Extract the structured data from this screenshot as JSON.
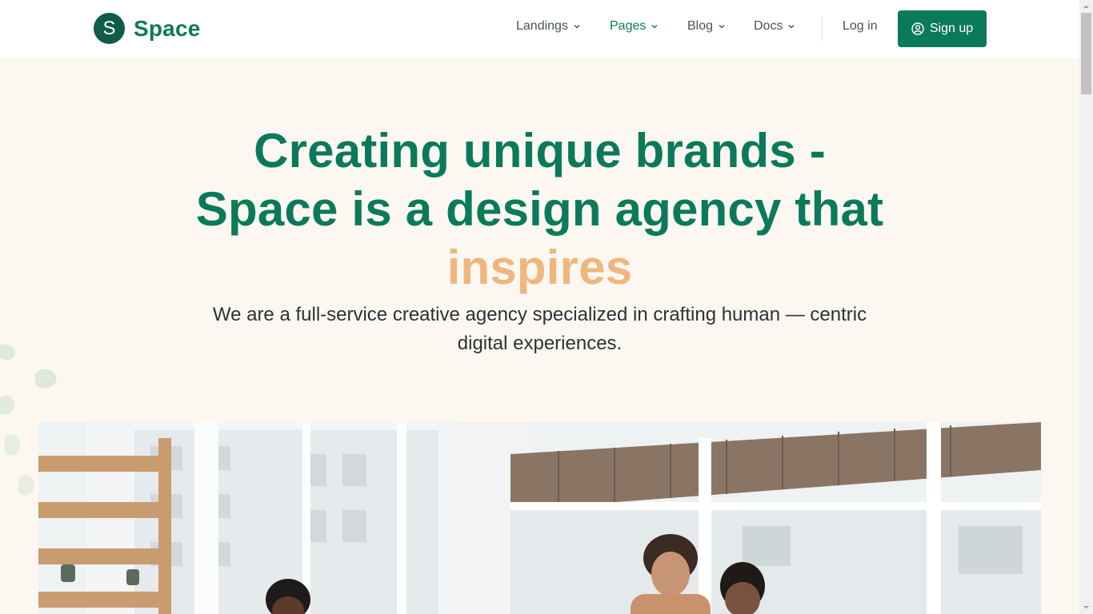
{
  "brand": {
    "badge_letter": "S",
    "name": "Space"
  },
  "nav": {
    "items": [
      {
        "label": "Landings",
        "active": false
      },
      {
        "label": "Pages",
        "active": true
      },
      {
        "label": "Blog",
        "active": false
      },
      {
        "label": "Docs",
        "active": false
      }
    ],
    "login_label": "Log in",
    "signup_label": "Sign up"
  },
  "hero": {
    "title_line1": "Creating unique brands -",
    "title_line2": "Space is a design agency that",
    "title_accent": "inspires",
    "subtitle": "We are a full-service creative agency specialized in crafting human — centric digital experiences."
  },
  "colors": {
    "brand_green": "#0b7a5a",
    "badge_green": "#0f5c48",
    "accent_peach": "#efb77d",
    "hero_bg": "#fcf7f1"
  },
  "icons": {
    "chevron": "chevron-down-icon",
    "signup": "user-circle-icon"
  }
}
